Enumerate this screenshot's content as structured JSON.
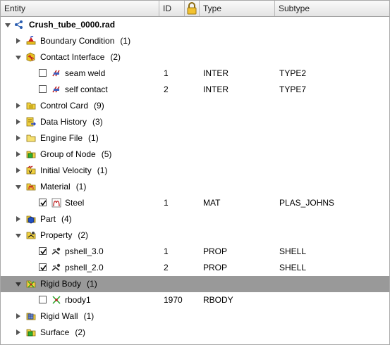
{
  "columns": {
    "entity": "Entity",
    "id": "ID",
    "type": "Type",
    "subtype": "Subtype",
    "lock_icon": "lock-icon"
  },
  "colors": {
    "selected_row": "#999999",
    "header_bg": "#ececec"
  },
  "tree": {
    "root_label": "Crush_tube_0000.rad",
    "rows": [
      {
        "label": "Boundary Condition",
        "count": "(1)"
      },
      {
        "label": "Contact Interface",
        "count": "(2)"
      },
      {
        "label": "seam weld",
        "id": "1",
        "type": "INTER",
        "subtype": "TYPE2",
        "checked": false
      },
      {
        "label": "self contact",
        "id": "2",
        "type": "INTER",
        "subtype": "TYPE7",
        "checked": false
      },
      {
        "label": "Control Card",
        "count": "(9)"
      },
      {
        "label": "Data History",
        "count": "(3)"
      },
      {
        "label": "Engine File",
        "count": "(1)"
      },
      {
        "label": "Group of Node",
        "count": "(5)"
      },
      {
        "label": "Initial Velocity",
        "count": "(1)"
      },
      {
        "label": "Material",
        "count": "(1)"
      },
      {
        "label": "Steel",
        "id": "1",
        "type": "MAT",
        "subtype": "PLAS_JOHNS",
        "checked": true
      },
      {
        "label": "Part",
        "count": "(4)"
      },
      {
        "label": "Property",
        "count": "(2)"
      },
      {
        "label": "pshell_3.0",
        "id": "1",
        "type": "PROP",
        "subtype": "SHELL",
        "checked": true
      },
      {
        "label": "pshell_2.0",
        "id": "2",
        "type": "PROP",
        "subtype": "SHELL",
        "checked": true
      },
      {
        "label": "Rigid Body",
        "count": "(1)",
        "selected": true
      },
      {
        "label": "rbody1",
        "id": "1970",
        "type": "RBODY",
        "subtype": "",
        "checked": false
      },
      {
        "label": "Rigid Wall",
        "count": "(1)"
      },
      {
        "label": "Surface",
        "count": "(2)"
      }
    ]
  }
}
